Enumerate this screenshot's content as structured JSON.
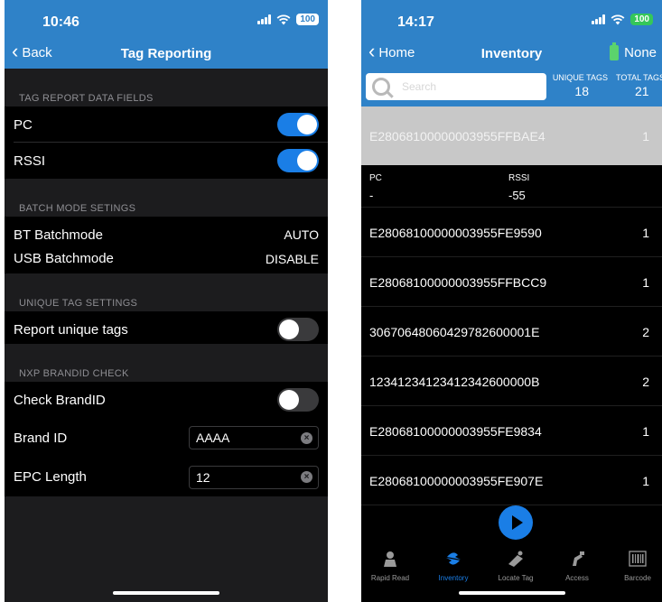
{
  "left": {
    "status": {
      "time": "10:46",
      "battery": "100"
    },
    "nav": {
      "back": "Back",
      "title": "Tag Reporting"
    },
    "sections": [
      {
        "header": "TAG REPORT DATA FIELDS"
      },
      {
        "header": "BATCH MODE SETINGS"
      },
      {
        "header": "UNIQUE TAG SETTINGS"
      },
      {
        "header": "NXP BRANDID CHECK"
      }
    ],
    "rows": {
      "pc": {
        "label": "PC",
        "on": true
      },
      "rssi": {
        "label": "RSSI",
        "on": true
      },
      "bt": {
        "label": "BT Batchmode",
        "value": "AUTO"
      },
      "usb": {
        "label": "USB Batchmode",
        "value": "DISABLE"
      },
      "unique": {
        "label": "Report unique tags",
        "on": false
      },
      "check": {
        "label": "Check BrandID",
        "on": false
      },
      "brand": {
        "label": "Brand ID",
        "value": "AAAA"
      },
      "epc": {
        "label": "EPC Length",
        "value": "12"
      }
    }
  },
  "right": {
    "status": {
      "time": "14:17",
      "battery": "100"
    },
    "nav": {
      "back": "Home",
      "title": "Inventory",
      "reader": "None"
    },
    "search": {
      "placeholder": "Search"
    },
    "unique_tags": {
      "label": "UNIQUE TAGS",
      "value": "18"
    },
    "total_tags": {
      "label": "TOTAL TAGS",
      "value": "21"
    },
    "selected": {
      "epc": "E28068100000003955FFBAE4",
      "count": "1"
    },
    "detail": {
      "pc_label": "PC",
      "pc_value": "-",
      "rssi_label": "RSSI",
      "rssi_value": "-55"
    },
    "tags": [
      {
        "epc": "E28068100000003955FE9590",
        "count": "1"
      },
      {
        "epc": "E28068100000003955FFBCC9",
        "count": "1"
      },
      {
        "epc": "30670648060429782600001E",
        "count": "2"
      },
      {
        "epc": "12341234123412342600000B",
        "count": "2"
      },
      {
        "epc": "E28068100000003955FE9834",
        "count": "1"
      },
      {
        "epc": "E28068100000003955FE907E",
        "count": "1"
      }
    ],
    "tabs": [
      {
        "label": "Rapid Read",
        "icon": "rapid-read-icon"
      },
      {
        "label": "Inventory",
        "icon": "inventory-icon",
        "active": true
      },
      {
        "label": "Locate Tag",
        "icon": "locate-tag-icon"
      },
      {
        "label": "Access",
        "icon": "access-icon"
      },
      {
        "label": "Barcode",
        "icon": "barcode-icon"
      }
    ]
  }
}
